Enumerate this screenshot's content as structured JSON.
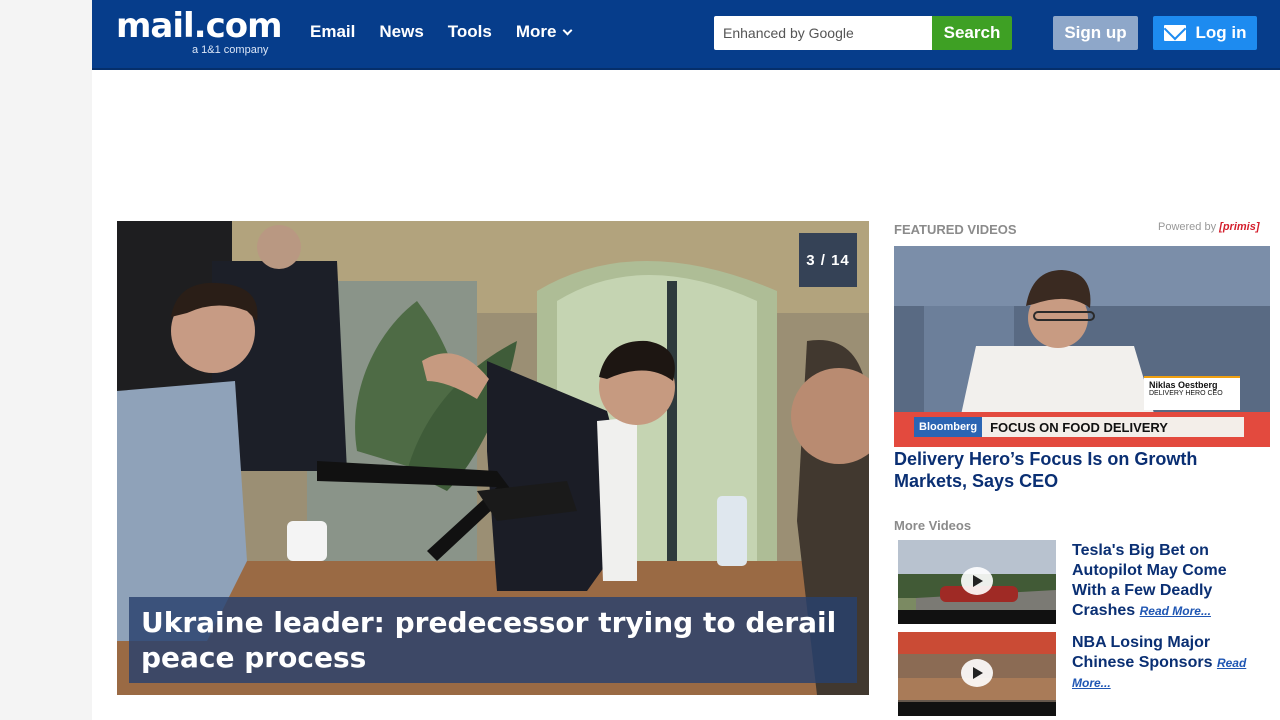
{
  "header": {
    "logo_text": "mail.com",
    "logo_sub": "a 1&1 company",
    "nav": [
      "Email",
      "News",
      "Tools",
      "More"
    ],
    "search_placeholder": "Enhanced by Google",
    "search_label": "Search",
    "signup_label": "Sign up",
    "login_label": "Log in"
  },
  "hero": {
    "slide_counter": "3 / 14",
    "headline": "Ukraine leader: predecessor trying to derail peace process"
  },
  "featured": {
    "label": "FEATURED VIDEOS",
    "powered_prefix": "Powered by",
    "powered_brand": "[primis]",
    "video_bar_brand": "Bloomberg",
    "video_bar_text": "FOCUS ON FOOD DELIVERY",
    "lower_third_name": "Niklas Oestberg",
    "lower_third_role": "DELIVERY HERO CEO",
    "title": "Delivery Hero’s Focus Is on Growth Markets, Says CEO"
  },
  "more_videos": {
    "label": "More Videos",
    "items": [
      {
        "title": "Tesla's Big Bet on Autopilot May Come With a Few Deadly Crashes",
        "link": "Read More..."
      },
      {
        "title": "NBA Losing Major Chinese Sponsors",
        "link": "Read More..."
      }
    ]
  }
}
